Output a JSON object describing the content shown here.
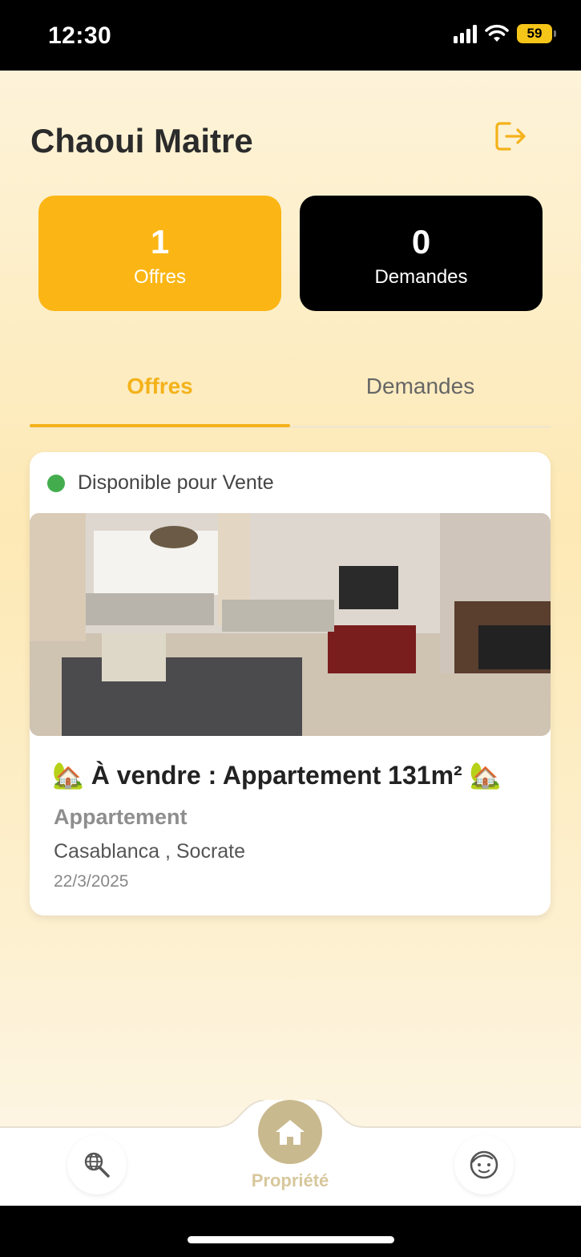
{
  "status_bar": {
    "time": "12:30",
    "battery": "59"
  },
  "header": {
    "user_name": "Chaoui Maitre",
    "logout_icon": "logout-icon"
  },
  "stats": {
    "offres": {
      "count": "1",
      "label": "Offres"
    },
    "demandes": {
      "count": "0",
      "label": "Demandes"
    }
  },
  "tabs": [
    {
      "label": "Offres",
      "active": true
    },
    {
      "label": "Demandes",
      "active": false
    }
  ],
  "listing": {
    "status": "Disponible pour Vente",
    "title": "🏡 À vendre : Appartement 131m² 🏡",
    "type": "Appartement",
    "location": "Casablanca , Socrate",
    "date": "22/3/2025"
  },
  "bottom_nav": {
    "items": [
      {
        "icon": "globe-search-icon"
      },
      {
        "icon": "home-icon",
        "label": "Propriété"
      },
      {
        "icon": "face-icon"
      }
    ]
  },
  "colors": {
    "accent": "#fbb615",
    "active_tab": "#f4b21a",
    "status_green": "#43ad4e",
    "nav_home": "#c9b98e"
  }
}
